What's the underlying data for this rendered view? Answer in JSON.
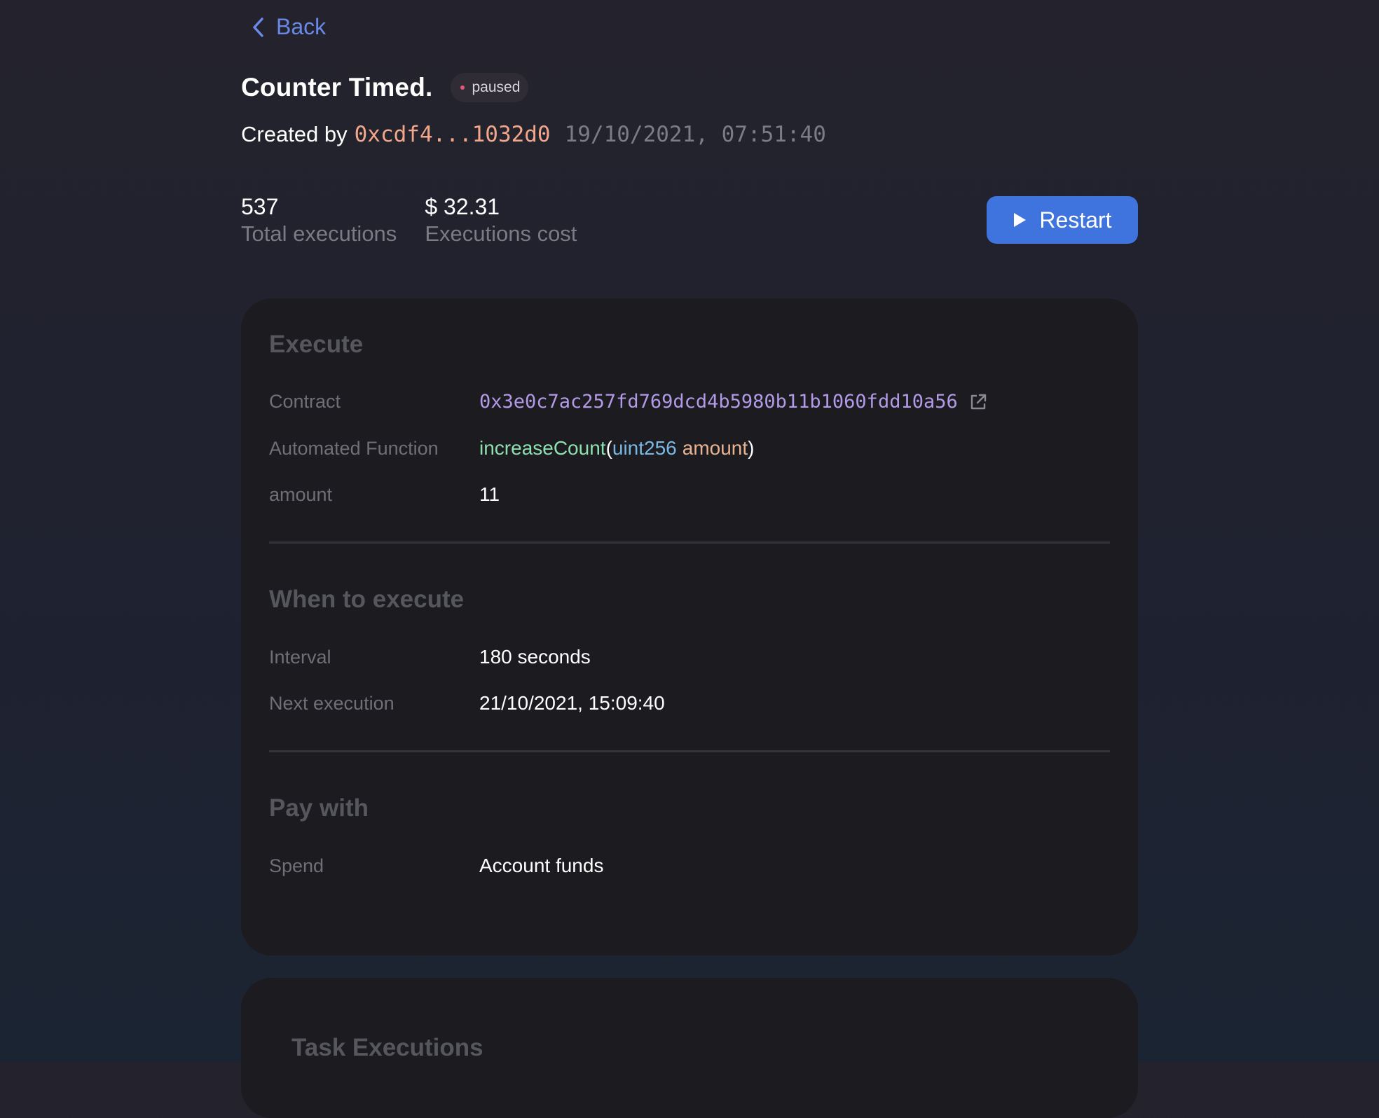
{
  "nav": {
    "back_label": "Back"
  },
  "task": {
    "title": "Counter Timed.",
    "status": "paused",
    "created_label": "Created by",
    "creator_address": "0xcdf4...1032d0",
    "created_date": "19/10/2021, 07:51:40"
  },
  "stats": {
    "executions_value": "537",
    "executions_label": "Total executions",
    "cost_value": "$ 32.31",
    "cost_label": "Executions cost"
  },
  "actions": {
    "restart_label": "Restart"
  },
  "execute": {
    "title": "Execute",
    "contract_label": "Contract",
    "contract_value": "0x3e0c7ac257fd769dcd4b5980b11b1060fdd10a56",
    "function_label": "Automated Function",
    "function_name": "increaseCount",
    "function_open": "(",
    "function_arg_type": "uint256",
    "function_arg_name": "amount",
    "function_close": ")",
    "amount_label": "amount",
    "amount_value": "11"
  },
  "when": {
    "title": "When to execute",
    "interval_label": "Interval",
    "interval_value": "180 seconds",
    "next_label": "Next execution",
    "next_value": "21/10/2021, 15:09:40"
  },
  "pay": {
    "title": "Pay with",
    "spend_label": "Spend",
    "spend_value": "Account funds"
  },
  "executions": {
    "title": "Task Executions"
  },
  "colors": {
    "accent": "#3f73dd",
    "link": "#6a8ae8",
    "address": "#f3a78a",
    "contract": "#b39ae7",
    "status_dot": "#e2577a"
  }
}
